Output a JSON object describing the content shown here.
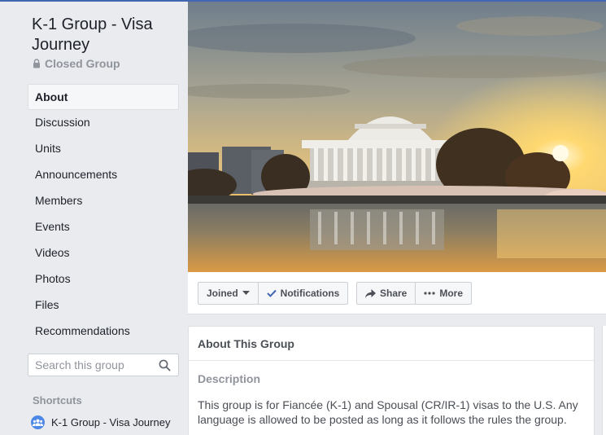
{
  "group": {
    "title": "K-1 Group - Visa Journey",
    "privacy": "Closed Group"
  },
  "nav": [
    {
      "label": "About",
      "active": true
    },
    {
      "label": "Discussion"
    },
    {
      "label": "Units"
    },
    {
      "label": "Announcements"
    },
    {
      "label": "Members"
    },
    {
      "label": "Events"
    },
    {
      "label": "Videos"
    },
    {
      "label": "Photos"
    },
    {
      "label": "Files"
    },
    {
      "label": "Recommendations"
    }
  ],
  "search": {
    "placeholder": "Search this group"
  },
  "shortcuts": {
    "label": "Shortcuts",
    "items": [
      {
        "label": "K-1 Group - Visa Journey"
      }
    ]
  },
  "actions": {
    "joined": "Joined",
    "notifications": "Notifications",
    "share": "Share",
    "more": "More"
  },
  "about_card": {
    "title": "About This Group",
    "section": "Description",
    "text": "This group is for Fiancée (K-1) and Spousal (CR/IR-1) visas to the U.S. Any language is allowed to be posted as long as it follows the rules the group."
  },
  "colors": {
    "brand": "#4267b2",
    "background": "#e9ebee",
    "check": "#4267b2"
  }
}
